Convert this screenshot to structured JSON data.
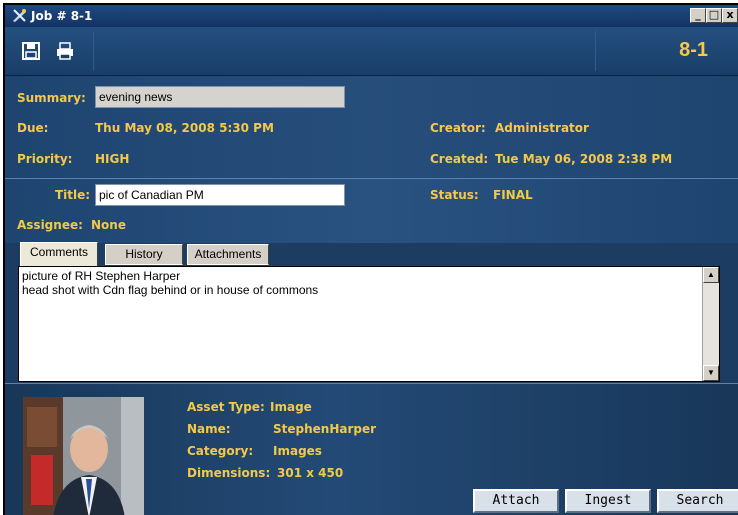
{
  "window": {
    "title": "Job # 8-1",
    "job_number": "8-1"
  },
  "window_controls": {
    "minimize": "_",
    "maximize": "□",
    "close": "x"
  },
  "form": {
    "summary_label": "Summary:",
    "summary_value": "evening news",
    "due_label": "Due:",
    "due_value": "Thu May 08, 2008 5:30 PM",
    "priority_label": "Priority:",
    "priority_value": "HIGH",
    "creator_label": "Creator:",
    "creator_value": "Administrator",
    "created_label": "Created:",
    "created_value": "Tue May 06, 2008 2:38 PM",
    "title_label": "Title:",
    "title_value": "pic of Canadian PM",
    "status_label": "Status:",
    "status_value": "FINAL",
    "assignee_label": "Assignee:",
    "assignee_value": "None"
  },
  "tabs": [
    "Comments",
    "History",
    "Attachments"
  ],
  "comments": {
    "line1": "picture of RH Stephen Harper",
    "line2": "head shot with Cdn flag behind or in house of commons"
  },
  "asset": {
    "type_label": "Asset Type:",
    "type_value": "Image",
    "name_label": "Name:",
    "name_value": "StephenHarper",
    "category_label": "Category:",
    "category_value": "Images",
    "dimensions_label": "Dimensions:",
    "dimensions_value": "301 x 450"
  },
  "buttons": {
    "attach": "Attach",
    "ingest": "Ingest",
    "search": "Search"
  },
  "icons": {
    "save": "save-icon",
    "print": "print-icon",
    "app": "app-logo-icon"
  },
  "colors": {
    "label": "#f4c94a",
    "panel": "#1e4470",
    "job_number": "#f6c94a"
  }
}
